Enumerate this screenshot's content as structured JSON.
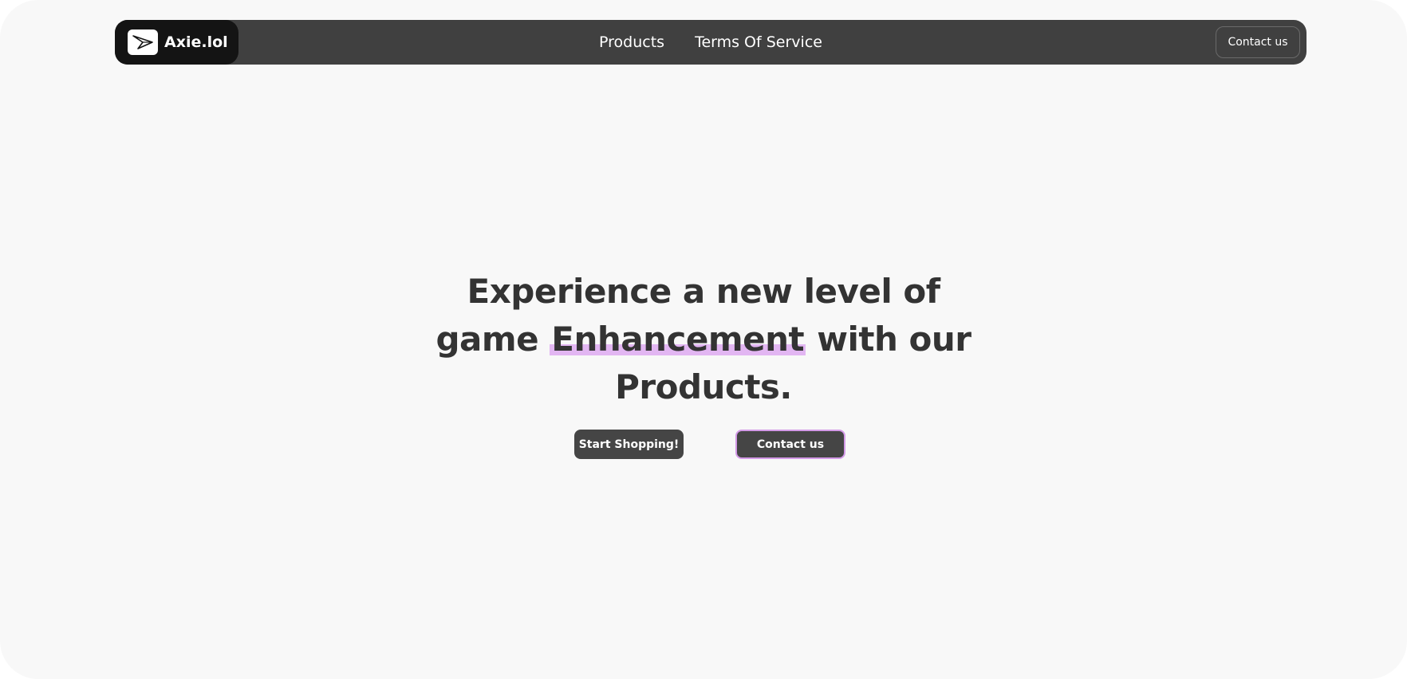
{
  "colors": {
    "page_background": "#f8f8f8",
    "navbar_background": "#404040",
    "brand_background": "#141414",
    "button_background": "#454545",
    "accent_highlight": "#e2b6f2",
    "accent_border": "#d49ae8",
    "heading_text": "#333333"
  },
  "navbar": {
    "brand": {
      "logo_icon": "paper-plane-icon",
      "name": "Axie.lol"
    },
    "links": [
      {
        "label": "Products"
      },
      {
        "label": "Terms Of Service"
      }
    ],
    "contact_label": "Contact us"
  },
  "hero": {
    "title_part1": "Experience a new level of game",
    "title_highlight": "Enhancement",
    "title_part2": "with our Products.",
    "primary_button": "Start Shopping!",
    "secondary_button": "Contact us"
  }
}
